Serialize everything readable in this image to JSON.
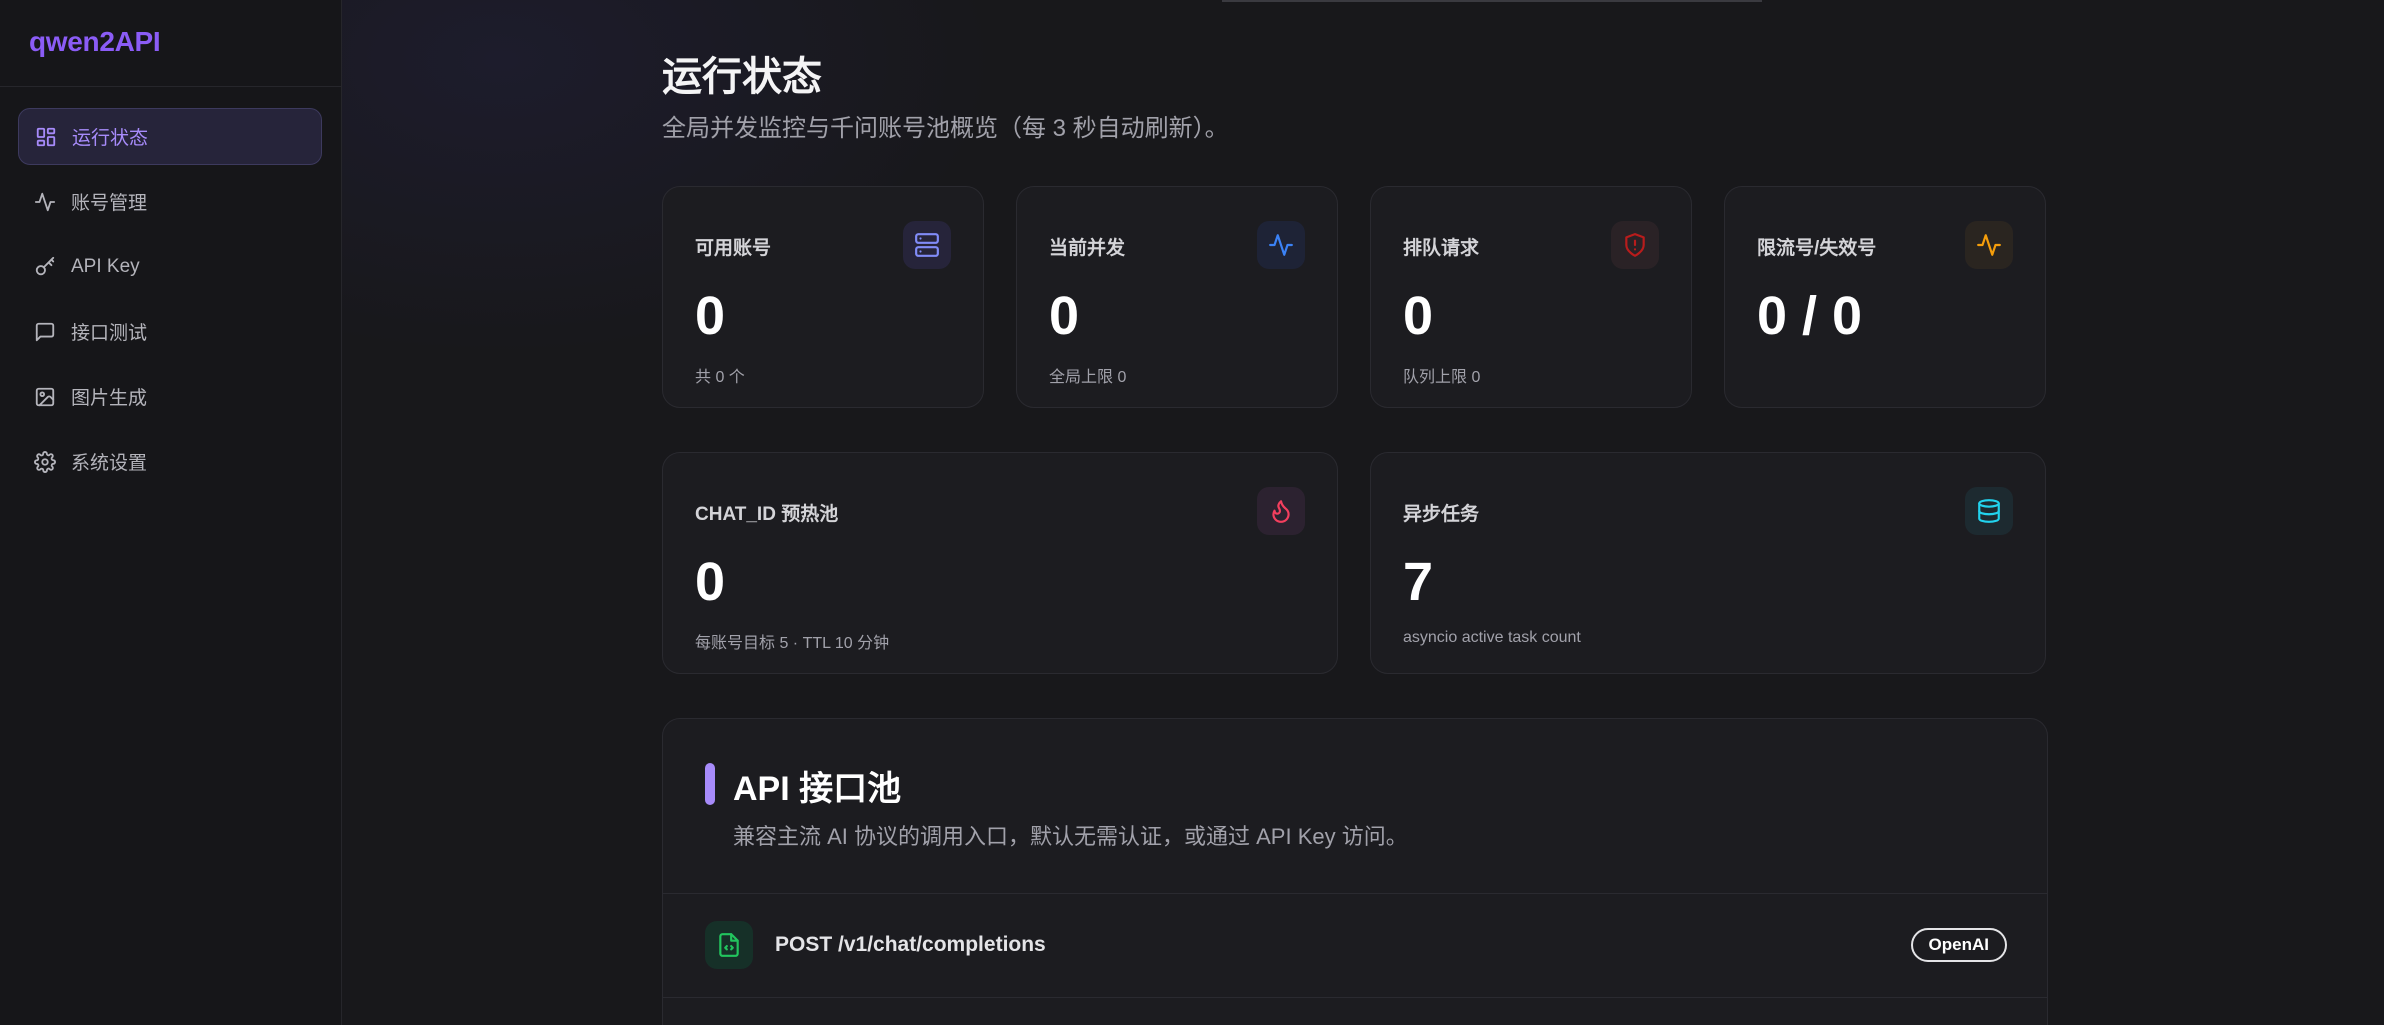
{
  "brand": "qwen2API",
  "nav": [
    {
      "label": "运行状态",
      "icon": "dashboard-icon",
      "active": true
    },
    {
      "label": "账号管理",
      "icon": "activity-icon"
    },
    {
      "label": "API Key",
      "icon": "key-icon"
    },
    {
      "label": "接口测试",
      "icon": "message-icon"
    },
    {
      "label": "图片生成",
      "icon": "image-icon"
    },
    {
      "label": "系统设置",
      "icon": "gear-icon"
    }
  ],
  "page": {
    "title": "运行状态",
    "subtitle": "全局并发监控与千问账号池概览（每 3 秒自动刷新）。"
  },
  "stats": [
    {
      "label": "可用账号",
      "value": "0",
      "caption": "共 0 个",
      "icon": "server-icon",
      "color": "#818cf8"
    },
    {
      "label": "当前并发",
      "value": "0",
      "caption": "全局上限 0",
      "icon": "activity-icon",
      "color": "#3b82f6"
    },
    {
      "label": "排队请求",
      "value": "0",
      "caption": "队列上限 0",
      "icon": "shield-alert-icon",
      "color": "#b91c1c"
    },
    {
      "label": "限流号/失效号",
      "value": "0 / 0",
      "caption": "",
      "icon": "activity-icon",
      "color": "#f59e0b"
    },
    {
      "label": "CHAT_ID 预热池",
      "value": "0",
      "caption": "每账号目标 5 · TTL 10 分钟",
      "icon": "flame-icon",
      "color": "#f43f5e"
    },
    {
      "label": "异步任务",
      "value": "7",
      "caption": "asyncio active task count",
      "icon": "database-icon",
      "color": "#22d3ee"
    }
  ],
  "api_pool": {
    "title": "API 接口池",
    "subtitle": "兼容主流 AI 协议的调用入口，默认无需认证，或通过 API Key 访问。",
    "endpoints": [
      {
        "path": "POST /v1/chat/completions",
        "badge": "OpenAI",
        "icon": "file-code-icon",
        "color": "#22c55e"
      }
    ]
  }
}
